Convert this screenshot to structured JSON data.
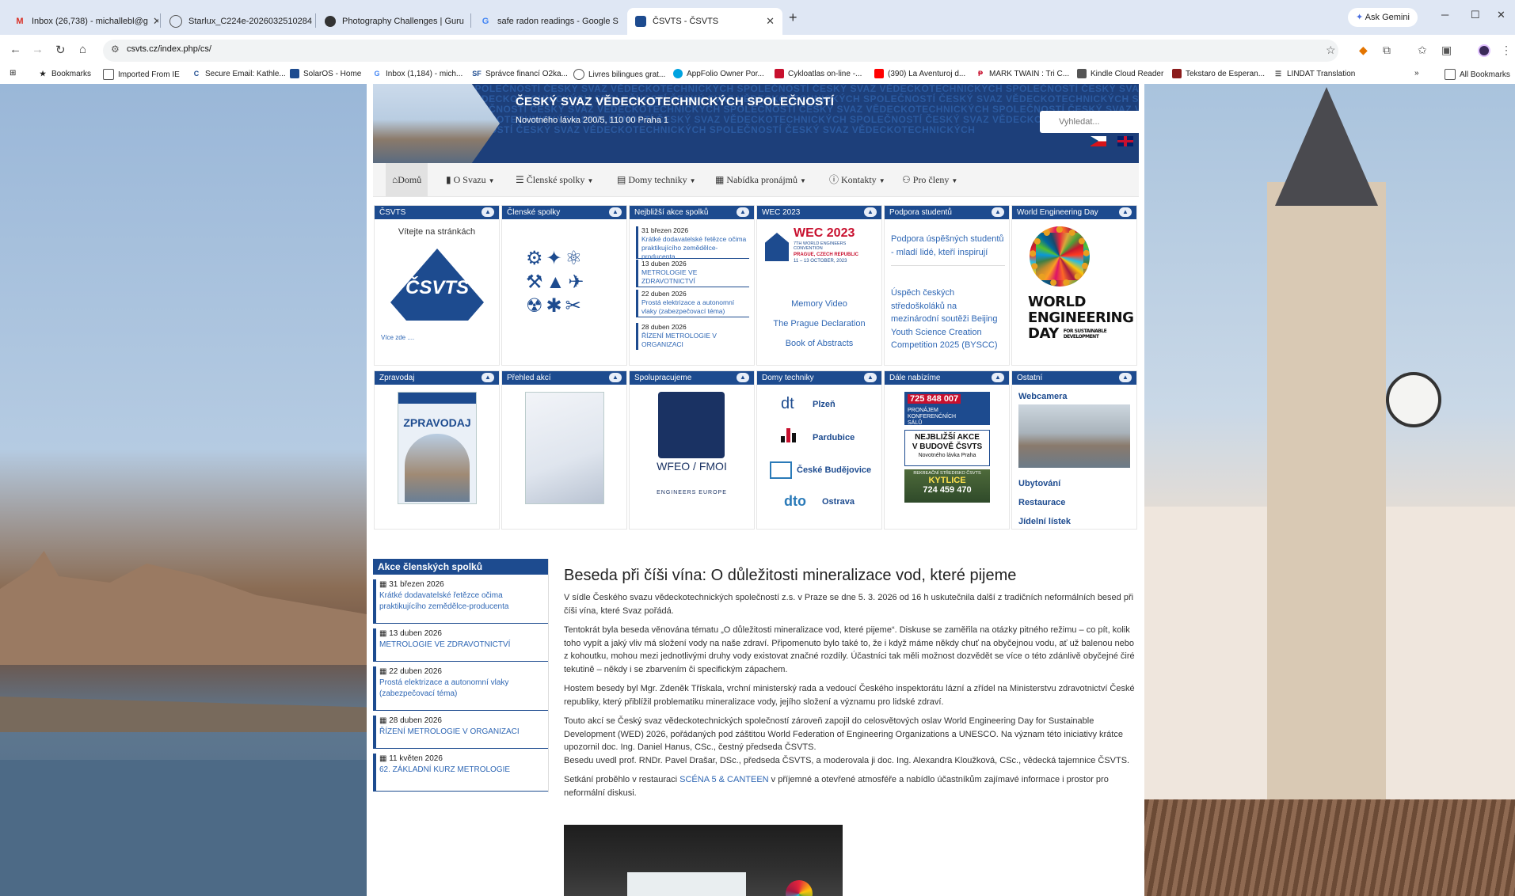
{
  "browser": {
    "tabs": [
      {
        "label": "Inbox (26,738) - michallebl@g",
        "favicon": "gmail-icon",
        "active": false
      },
      {
        "label": "Starlux_C224e-2026032510284",
        "favicon": "globe-icon",
        "active": false
      },
      {
        "label": "Photography Challenges | Guru",
        "favicon": "gurushots-icon",
        "active": false
      },
      {
        "label": "safe radon readings - Google S",
        "favicon": "google-icon",
        "active": false
      },
      {
        "label": "ČSVTS - ČSVTS",
        "favicon": "csvts-icon",
        "active": true
      }
    ],
    "new_tab": "+",
    "gemini_label": "Ask Gemini",
    "url": "csvts.cz/index.php/cs/",
    "bookmarks": [
      "Bookmarks",
      "Imported From IE",
      "Secure Email: Kathle...",
      "SolarOS - Home",
      "Inbox (1,184) - mich...",
      "Správce financí O2ka...",
      "Livres bilingues grat...",
      "AppFolio Owner Por...",
      "Cykloatlas on-line -...",
      "(390) La Aventuroj d...",
      "MARK TWAIN : Tri C...",
      "Kindle Cloud Reader",
      "Tekstaro de Esperan...",
      "LINDAT Translation"
    ],
    "bookmarks_overflow": "»",
    "all_bookmarks": "All Bookmarks"
  },
  "site": {
    "title": "ČESKÝ SVAZ VĚDECKOTECHNICKÝCH SPOLEČNOSTÍ",
    "address": "Novotného lávka 200/5, 110 00 Praha 1",
    "banner_pattern": "SPOLEČNOSTÍ ČESKÝ SVAZ VĚDECKOTECHNICKÝCH SPOLEČNOSTÍ ČESKÝ SVAZ VĚDECKOTECHNICKÝCH SPOLEČNOSTÍ ČESKÝ SVAZ VĚDECKOTECHNICKÝCH SPOLEČNOSTÍ ČESKÝ SVAZ VĚDECKOTECHNICKÝCH SPOLEČNOSTÍ ČESKÝ SVAZ VĚDECKOTECHNICKÝCH SPOLEČNOSTÍ ČESKÝ SVAZ VĚDECKOTECHNICKÝCH SPOLEČNOSTÍ ČESKÝ SVAZ VĚDECKOTECHNICKÝCH SPOLEČNOSTÍ ČESKÝ SVAZ VĚDECKOTECHNICKÝCH SPOLEČNOSTÍ ČESKÝ SVAZ VĚDECKOTECHNICKÝCH SPOLEČNOSTÍ ČESKÝ SVAZ VĚDECKOTECHNICKÝCH SPOLEČNOSTÍ ČESKÝ SVAZ VĚDECKOTECHNICKÝCH SPOLEČNOSTÍ ČESKÝ SVAZ VĚDECKOTECHNICKÝCH",
    "search_placeholder": "Vyhledat..."
  },
  "nav": [
    {
      "label": "Domů",
      "icon": "home-icon",
      "active": true
    },
    {
      "label": "O Svazu",
      "icon": "bookmark-icon"
    },
    {
      "label": "Členské spolky",
      "icon": "list-icon"
    },
    {
      "label": "Domy techniky",
      "icon": "book-icon"
    },
    {
      "label": "Nabídka pronájmů",
      "icon": "grid-icon"
    },
    {
      "label": "Kontakty",
      "icon": "info-icon"
    },
    {
      "label": "Pro členy",
      "icon": "users-icon"
    }
  ],
  "panels_row1": {
    "csvts": {
      "head": "ČSVTS",
      "welcome": "Vítejte na stránkách",
      "logo_text": "ČSVTS",
      "more": "Více zde ...."
    },
    "clenske": {
      "head": "Členské spolky"
    },
    "akce": {
      "head": "Nejbližší akce spolků",
      "events": [
        {
          "date": "31 březen 2026",
          "title": "Krátké dodavatelské řetězce očima praktikujícího zemědělce-producenta"
        },
        {
          "date": "13 duben 2026",
          "title": "METROLOGIE VE ZDRAVOTNICTVÍ"
        },
        {
          "date": "22 duben 2026",
          "title": "Prostá elektrizace a autonomní vlaky (zabezpečovací téma)"
        },
        {
          "date": "28 duben 2026",
          "title": "ŘÍZENÍ METROLOGIE V ORGANIZACI"
        }
      ]
    },
    "wec": {
      "head": "WEC 2023",
      "logo_title": "WEC 2023",
      "logo_sub1": "7TH WORLD ENGINEERS CONVENTION",
      "logo_sub2": "PRAGUE, CZECH REPUBLIC",
      "logo_sub3": "11 – 13 OCTOBER, 2023",
      "links": [
        "Memory Video",
        "The Prague Declaration",
        "Book of Abstracts"
      ]
    },
    "podpora": {
      "head": "Podpora studentů",
      "link1": "Podpora úspěšných studentů - mladí lidé, kteří inspirují",
      "link2": "Úspěch českých středoškoláků na mezinárodní soutěži Beijing Youth Science Creation Competition 2025 (BYSCC)"
    },
    "wed": {
      "head": "World Engineering Day",
      "logo_l1": "WORLD",
      "logo_l2": "ENGINEERING",
      "logo_l3": "DAY",
      "logo_sub": "FOR SUSTAINABLE DEVELOPMENT"
    }
  },
  "panels_row2": {
    "zpravodaj": {
      "head": "Zpravodaj",
      "cover_title": "ZPRAVODAJ"
    },
    "prehled": {
      "head": "Přehled akcí"
    },
    "spoluprace": {
      "head": "Spolupracujeme",
      "wfeo": "WFEO / FMOI",
      "engineers": "ENGINEERS EUROPE"
    },
    "domy": {
      "head": "Domy techniky",
      "items": [
        {
          "logo": "dt",
          "city": "Plzeň"
        },
        {
          "logo": "dt",
          "city": "Pardubice"
        },
        {
          "logo": "dt",
          "city": "České Budějovice"
        },
        {
          "logo": "dto",
          "city": "Ostrava"
        }
      ]
    },
    "dale": {
      "head": "Dále nabízíme",
      "ad1_phone": "725 848 007",
      "ad1_text": "PRONÁJEM KONFERENČNÍCH SÁLŮ",
      "ad2_l1": "NEJBLIŽŠÍ AKCE",
      "ad2_l2": "V BUDOVĚ ČSVTS",
      "ad2_l3": "Novotného lávka Praha",
      "ad3_l1": "REKREAČNÍ STŘEDISKO ČSVTS",
      "ad3_l2": "KYTLICE",
      "ad3_l3": "724 459 470"
    },
    "ostatni": {
      "head": "Ostatní",
      "webcam": "Webcamera",
      "links": [
        "Ubytování",
        "Restaurace",
        "Jídelní lístek"
      ]
    }
  },
  "side_events": {
    "head": "Akce členských spolků",
    "items": [
      {
        "date": "31 březen 2026",
        "title": "Krátké dodavatelské řetězce očima praktikujícího zemědělce-producenta"
      },
      {
        "date": "13 duben 2026",
        "title": "METROLOGIE VE ZDRAVOTNICTVÍ"
      },
      {
        "date": "22 duben 2026",
        "title": "Prostá elektrizace a autonomní vlaky (zabezpečovací téma)"
      },
      {
        "date": "28 duben 2026",
        "title": "ŘÍZENÍ METROLOGIE V ORGANIZACI"
      },
      {
        "date": "11 květen 2026",
        "title": "62. ZÁKLADNÍ KURZ METROLOGIE"
      }
    ]
  },
  "article": {
    "title": "Beseda při číši vína: O důležitosti mineralizace vod, které pijeme",
    "p1": "V sídle Českého svazu vědeckotechnických společností z.s. v Praze se dne 5. 3. 2026 od 16 h uskutečnila další z tradičních neformálních besed při číši vína, které Svaz pořádá.",
    "p2": "Tentokrát byla beseda věnována tématu „O důležitosti mineralizace vod, které pijeme“. Diskuse se zaměřila na otázky pitného režimu – co pít, kolik toho vypít a jaký vliv má složení vody na naše zdraví. Připomenuto bylo také to, že i když máme někdy chuť na obyčejnou vodu, ať už balenou nebo z kohoutku, mohou mezi jednotlivými druhy vody existovat značné rozdíly. Účastníci tak měli možnost dozvědět se více o této zdánlivě obyčejné čiré tekutině – někdy i se zbarvením či specifickým zápachem.",
    "p3": "Hostem besedy byl Mgr. Zdeněk Třískala, vrchní ministerský rada a vedoucí Českého inspektorátu lázní a zřídel na Ministerstvu zdravotnictví České republiky, který přiblížil problematiku mineralizace vody, jejího složení a významu pro lidské zdraví.",
    "p4": "Touto akcí se Český svaz vědeckotechnických společností zároveň zapojil do celosvětových oslav World Engineering Day for Sustainable Development (WED) 2026, pořádaných pod záštitou World Federation of Engineering Organizations a UNESCO. Na význam této iniciativy krátce upozornil doc. Ing. Daniel Hanus, CSc., čestný předseda ČSVTS.",
    "p5": "Besedu uvedl prof. RNDr. Pavel Drašar, DSc., předseda ČSVTS, a moderovala ji doc. Ing. Alexandra Kloužková, CSc., vědecká tajemnice ČSVTS.",
    "p6_pre": "Setkání proběhlo v restauraci ",
    "p6_link": "SCÉNA 5 & CANTEEN",
    "p6_post": " v příjemné a otevřené atmosféře a nabídlo účastníkům zajímavé informace i prostor pro neformální diskusi."
  },
  "colors": {
    "brand_blue": "#1d4b8f",
    "link_blue": "#2f67b4",
    "wec_red": "#c8102e"
  }
}
